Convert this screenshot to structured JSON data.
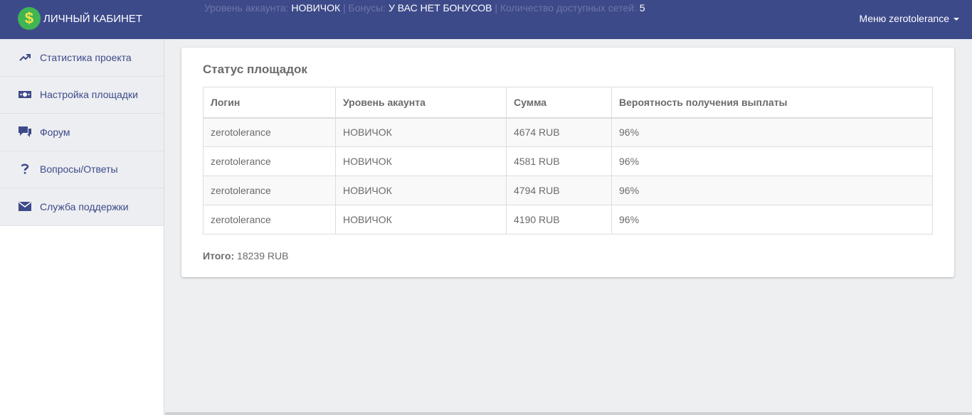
{
  "header": {
    "brand_symbol": "$",
    "brand_title": "ЛИЧНЫЙ КАБИНЕТ",
    "account_level_label": "Уровень аккаунта:",
    "account_level_value": "НОВИЧОК",
    "separator": "|",
    "bonuses_label": "Бонусы:",
    "bonuses_value": "У ВАС НЕТ БОНУСОВ",
    "networks_label": "Количество доступных сетей:",
    "networks_value": "5",
    "user_menu_label": "Меню zerotolerance"
  },
  "sidebar": {
    "items": [
      {
        "label": "Статистика проекта",
        "icon": "trending-up-icon"
      },
      {
        "label": "Настройка площадки",
        "icon": "money-icon"
      },
      {
        "label": "Форум",
        "icon": "chat-icon"
      },
      {
        "label": "Вопросы/Ответы",
        "icon": "question-icon"
      },
      {
        "label": "Служба поддержки",
        "icon": "envelope-icon"
      }
    ]
  },
  "main": {
    "card_title": "Статус площадок",
    "table": {
      "columns": [
        "Логин",
        "Уровень акаунта",
        "Сумма",
        "Вероятность получения выплаты"
      ],
      "rows": [
        [
          "zerotolerance",
          "НОВИЧОК",
          "4674 RUB",
          "96%"
        ],
        [
          "zerotolerance",
          "НОВИЧОК",
          "4581 RUB",
          "96%"
        ],
        [
          "zerotolerance",
          "НОВИЧОК",
          "4794 RUB",
          "96%"
        ],
        [
          "zerotolerance",
          "НОВИЧОК",
          "4190 RUB",
          "96%"
        ]
      ]
    },
    "total_label": "Итого:",
    "total_value": "18239 RUB"
  },
  "colors": {
    "header_bg": "#3d4a8a",
    "accent": "#3d4a8a",
    "brand_icon_bg": "#3fb553",
    "brand_icon_symbol": "#f6e14a"
  }
}
